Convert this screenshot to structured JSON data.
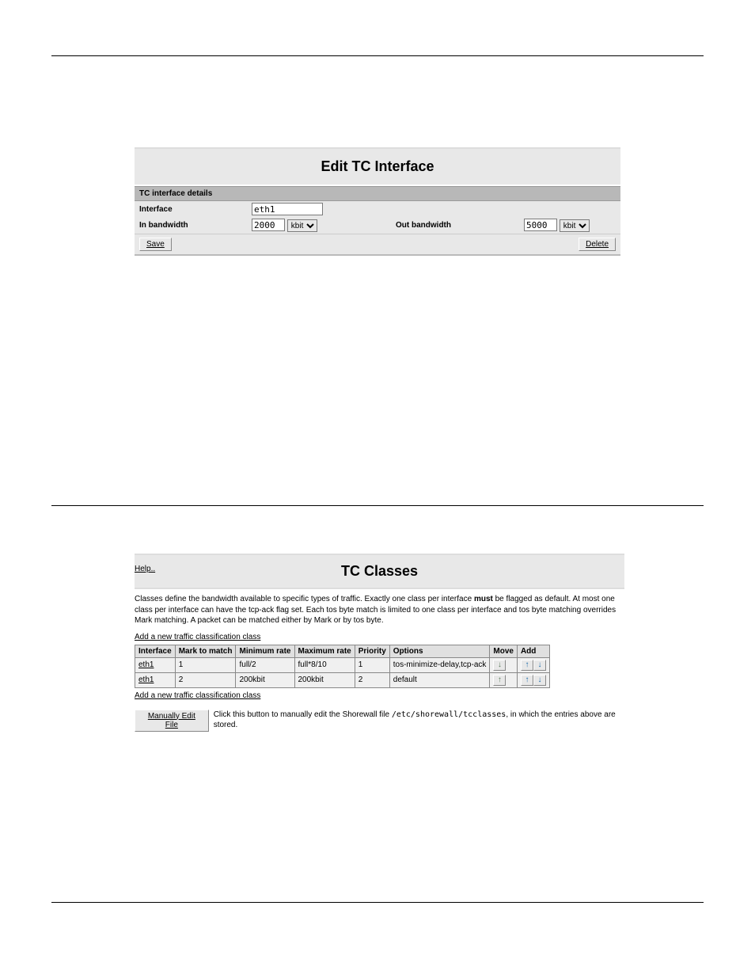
{
  "editTc": {
    "title": "Edit TC Interface",
    "detailsHeader": "TC interface details",
    "interfaceLabel": "Interface",
    "interfaceValue": "eth1",
    "inBwLabel": "In bandwidth",
    "inBwValue": "2000",
    "inBwUnit": "kbit",
    "outBwLabel": "Out bandwidth",
    "outBwValue": "5000",
    "outBwUnit": "kbit",
    "saveLabel": "Save",
    "deleteLabel": "Delete"
  },
  "tcClasses": {
    "helpLabel": "Help..",
    "title": "TC Classes",
    "description_part1": "Classes define the bandwidth available to specific types of traffic. Exactly one class per interface ",
    "description_must": "must",
    "description_part2": " be flagged as default. At most one class per interface can have the tcp-ack flag set. Each tos byte match is limited to one class per interface and tos byte matching overrides Mark matching. A packet can be matched either by Mark or by tos byte.",
    "addLink": "Add a new traffic classification class",
    "headers": {
      "interface": "Interface",
      "mark": "Mark to match",
      "minrate": "Minimum rate",
      "maxrate": "Maximum rate",
      "priority": "Priority",
      "options": "Options",
      "move": "Move",
      "add": "Add"
    },
    "rows": [
      {
        "interface": "eth1",
        "mark": "1",
        "min": "full/2",
        "max": "full*8/10",
        "priority": "1",
        "options": "tos-minimize-delay,tcp-ack"
      },
      {
        "interface": "eth1",
        "mark": "2",
        "min": "200kbit",
        "max": "200kbit",
        "priority": "2",
        "options": "default"
      }
    ],
    "manualBtn": "Manually Edit File",
    "manualTxtPre": "Click this button to manually edit the Shorewall file ",
    "manualPath": "/etc/shorewall/tcclasses",
    "manualTxtPost": ", in which the entries above are stored."
  }
}
